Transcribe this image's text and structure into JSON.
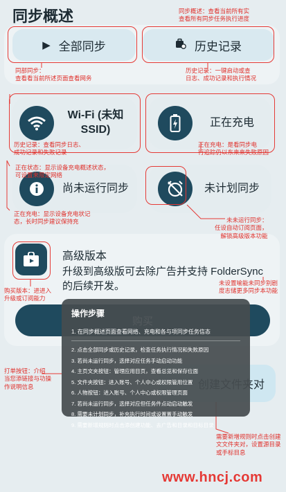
{
  "sync_overview": {
    "title": "同步概述",
    "all_sync_label": "全部同步",
    "history_label": "历史记录"
  },
  "cards": {
    "wifi_label": "Wi-Fi (未知\nSSID)",
    "charging_label": "正在充电",
    "not_run_label": "尚未运行同步",
    "not_scheduled_label": "未计划同步"
  },
  "pro": {
    "title": "高级版本",
    "desc": "升级到高级版可去除广告并支持 FolderSync 的后续开发。",
    "buy_label": "购买",
    "create_label": "创建文件夹对"
  },
  "annotations": {
    "overview": "同步概述：查看当前所有实\n查看所有同步任务执行进度",
    "all_sync": "同部同步：\n查看看当前所述页面查看网务",
    "history": "历史记录：一键启动或查\n日志、成功记录和执行情况",
    "wifi": "历史记录：查看同步日志、\n成功记录和失败记录",
    "charging": "正在充电：是看同步电\n行追踪仍以东来来失败原因",
    "status": "正在状态：显示设备充电概述状态，\n可设置来限定网络",
    "charge_state": "正在充电：显示设备充电状记\n态，长时同步建议保持充",
    "not_scheduled": "未未运行同步：\n任设自动订阅页面，\n解锁高级版本功能",
    "buy": "购买版本：进进入\n升级或订阅能力",
    "ads": "未设置喻能未同步别剧\n度志储更多同步本功能",
    "fab": "打单按钮：介绍\n当您添链接与功操\n作说明信息",
    "rule": "需要新增规则时点击创建\n文文件夹对，设置源目录\n或手标目息"
  },
  "guide": {
    "title": "操作步骤",
    "first": "1. 在同步概述页面查看网络、充电和各与项同步任务信态",
    "steps": [
      "2. 点击全部同步或历史记录，检查任务执行情况和失败原因",
      "3. 若尚未运行同步，选择对应任务手动启动功能",
      "4. 主页文夹按钮：管理应用目页，查看总览和保存位面",
      "5. 文件夹按钮：进入账号、个人中心或权限管用位置",
      "6. 人物按钮：进入账号、个人中心或权限管理页面",
      "7. 若尚未运行同步，选择对应但任务件点动启动触发",
      "8. 需要未计划同步，补充执行时间或设置置手动触发",
      "9. 需要新增规则时点击添创建功能、去广告和目录和目标目录"
    ]
  },
  "watermark": "www.hncj.com"
}
